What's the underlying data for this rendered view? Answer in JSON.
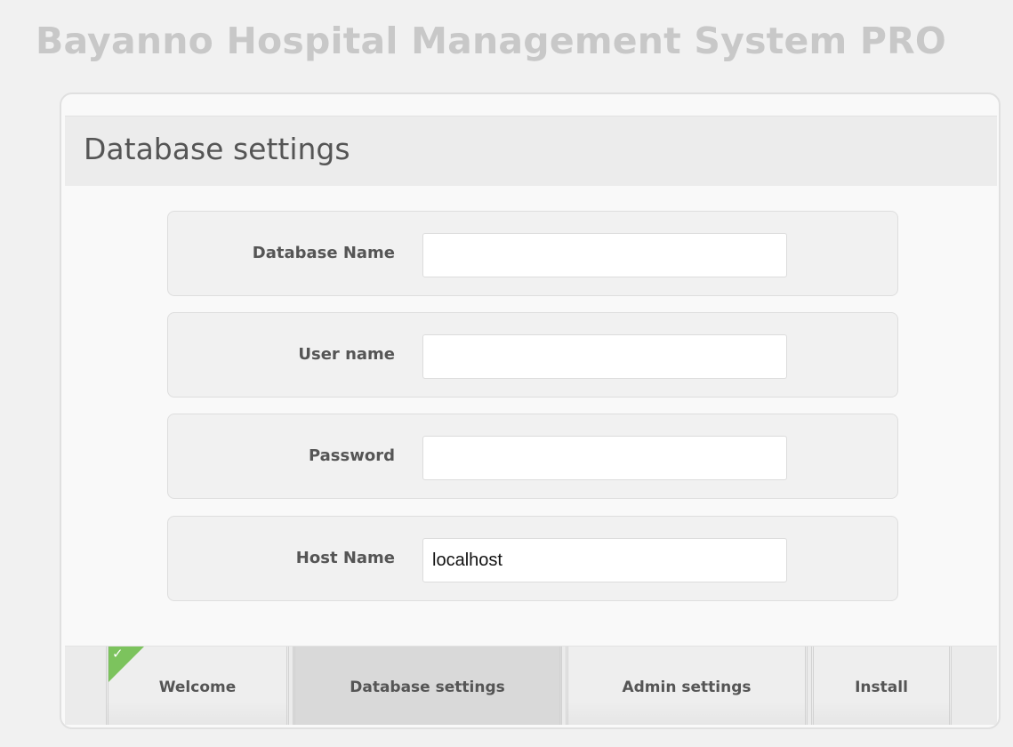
{
  "app": {
    "title": "Bayanno Hospital Management System PRO"
  },
  "panel": {
    "title": "Database settings"
  },
  "fields": [
    {
      "label": "Database Name",
      "value": "",
      "placeholder": ""
    },
    {
      "label": "User name",
      "value": "",
      "placeholder": ""
    },
    {
      "label": "Password",
      "value": "",
      "placeholder": ""
    },
    {
      "label": "Host Name",
      "value": "localhost",
      "placeholder": ""
    }
  ],
  "tabs": [
    {
      "label": "Welcome",
      "state": "completed",
      "icon": "checkmark-icon"
    },
    {
      "label": "Database settings",
      "state": "active"
    },
    {
      "label": "Admin settings",
      "state": "pending"
    },
    {
      "label": "Install",
      "state": "pending"
    }
  ],
  "colors": {
    "background": "#f1f1f1",
    "title_text": "#c8c8c8",
    "completed_accent": "#7cc35d",
    "active_tab": "#d9d9d9"
  }
}
